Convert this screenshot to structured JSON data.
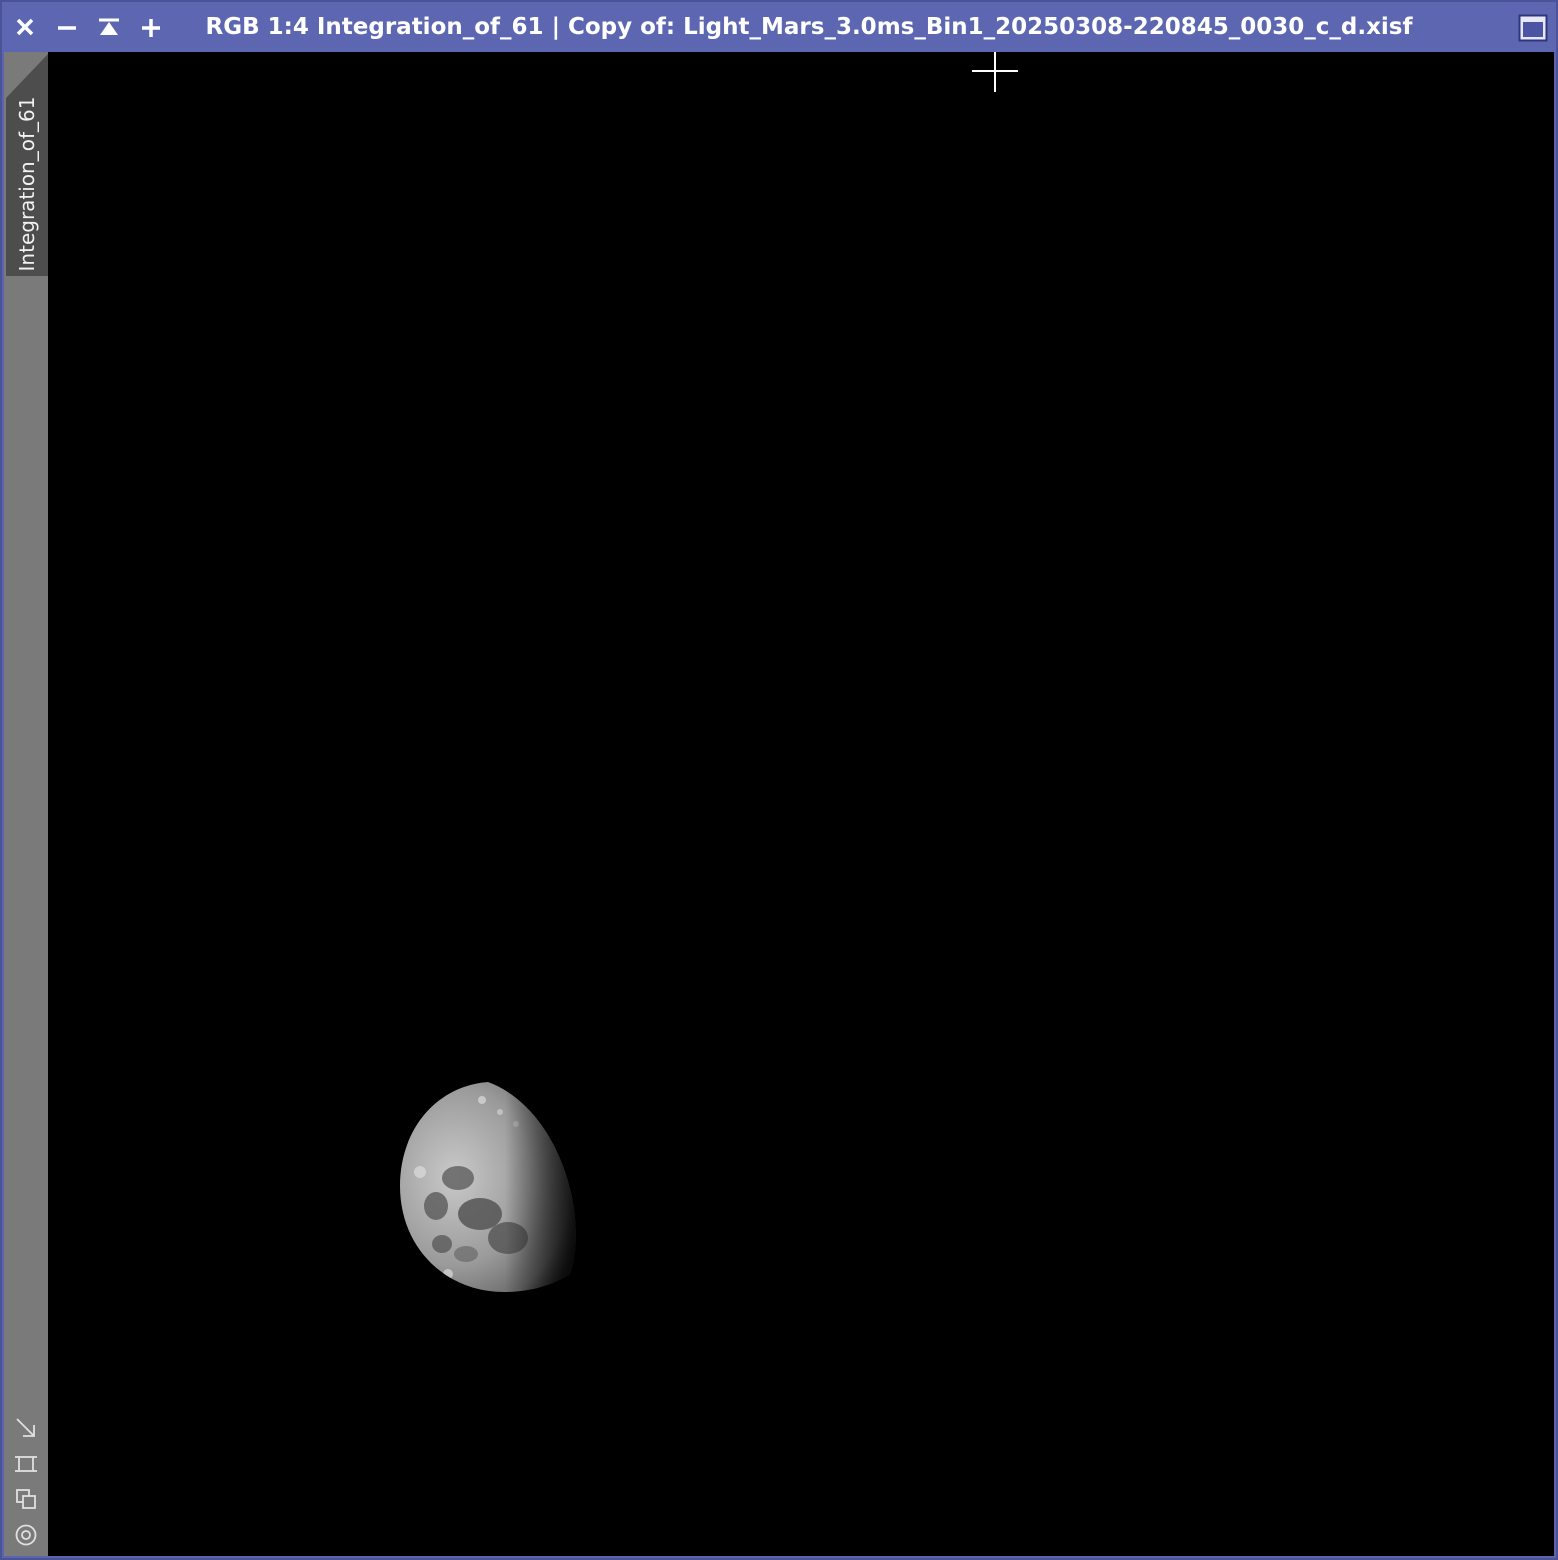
{
  "window": {
    "title": "RGB 1:4 Integration_of_61 | Copy of: Light_Mars_3.0ms_Bin1_20250308-220845_0030_c_d.xisf"
  },
  "sidebar": {
    "view_tab_label": "Integration_of_61",
    "tools": [
      "fit-view-icon",
      "crop-frame-icon",
      "clone-view-icon",
      "target-icon"
    ]
  },
  "colors": {
    "titlebar": "#5d67b1",
    "sidebar": "#7a7a7a",
    "tab": "#4d4d4d",
    "canvas": "#000000"
  }
}
